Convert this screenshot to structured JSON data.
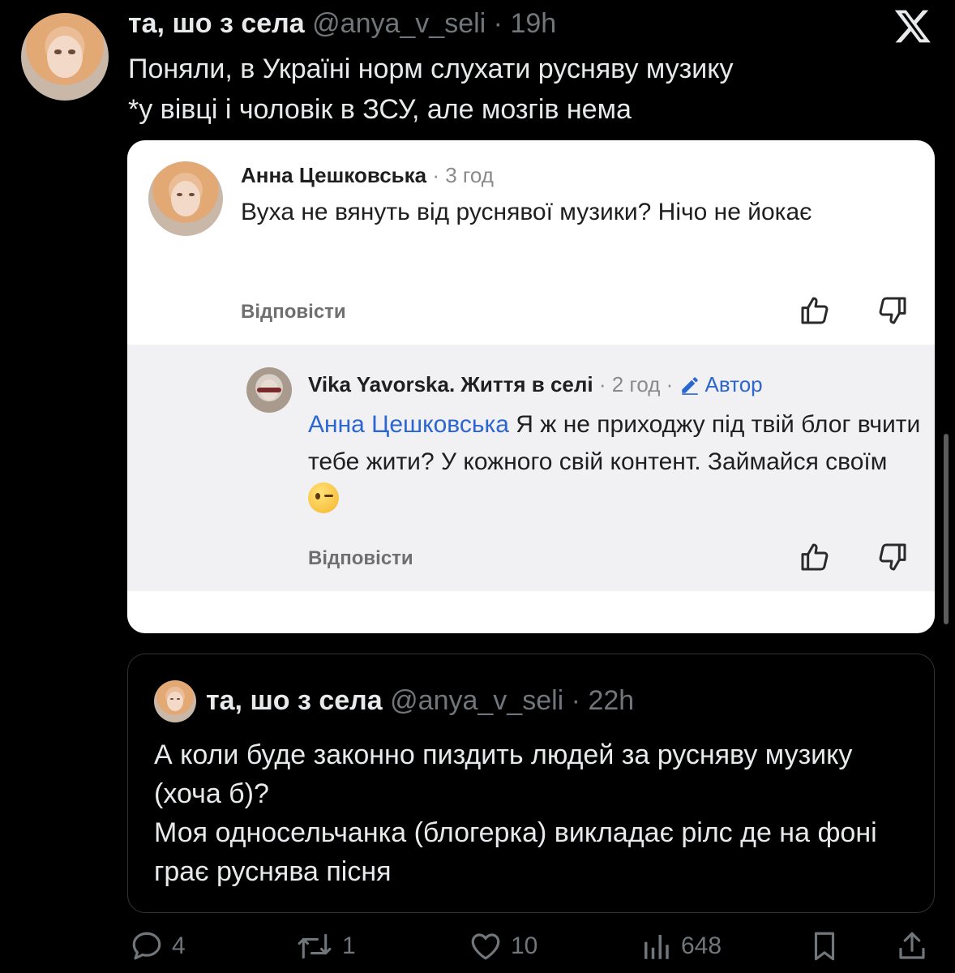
{
  "header": {
    "name": "та, шо з села",
    "handle": "@anya_v_seli",
    "sep": " · ",
    "time": "19h",
    "text": "Поняли, в Україні норм слухати русняву музику\n*у вівці і чоловік в ЗСУ, але мозгів нема"
  },
  "comment": {
    "author": "Анна Цешковська",
    "time": " · 3 год",
    "text": "Вуха не вянуть від руснявої музики? Нічо не йокає",
    "reply_label": "Відповісти"
  },
  "reply": {
    "author": "Vika Yavorska. Життя в селі",
    "time": " · 2 год · ",
    "badge": "Автор",
    "mention": "Анна Цешковська",
    "text": "  Я ж не приходжу під твій блог вчити тебе жити?   У кожного свій контент. Займайся своїм ",
    "reply_label": "Відповісти"
  },
  "quote": {
    "name": "та, шо з села",
    "handle": "@anya_v_seli",
    "sep": " · ",
    "time": "22h",
    "text": "А коли буде законно пиздить людей за русняву музику (хоча б)?\nМоя односельчанка (блогерка) викладає рілс де на фоні грає руснява пісня"
  },
  "actions": {
    "replies": "4",
    "reposts": "1",
    "likes": "10",
    "views": "648"
  },
  "icons": {
    "logo": "x-logo-icon",
    "like": "thumbs-up-icon",
    "dislike": "thumbs-down-icon",
    "edit": "pencil-icon",
    "reply": "speech-bubble-icon",
    "repost": "repost-icon",
    "heart": "heart-icon",
    "views": "bar-chart-icon",
    "bookmark": "bookmark-icon",
    "share": "share-icon"
  }
}
